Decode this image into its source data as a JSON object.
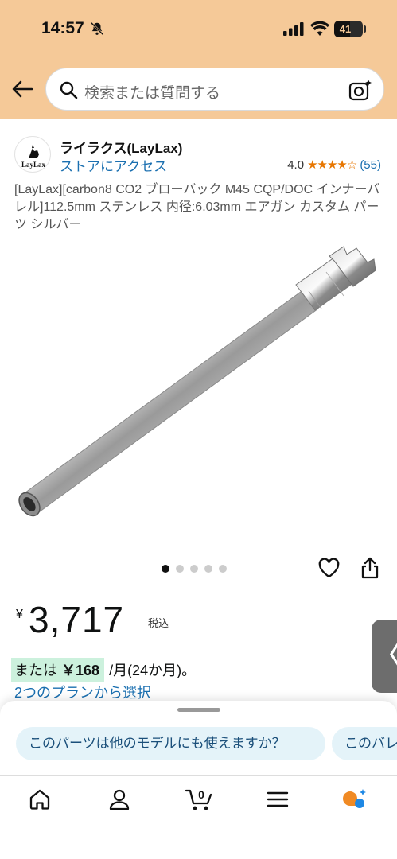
{
  "status_bar": {
    "time": "14:57",
    "battery": "41"
  },
  "search": {
    "placeholder": "検索または質問する"
  },
  "brand": {
    "name": "ライラクス(LayLax)",
    "store_link": "ストアにアクセス",
    "logo_text": "LayLax"
  },
  "rating": {
    "value": "4.0",
    "stars": "★★★★☆",
    "count": "(55)"
  },
  "product": {
    "title": "[LayLax][carbon8 CO2 ブローバック M45 CQP/DOC インナーバレル]112.5mm ステンレス 内径:6.03mm エアガン カスタム パーツ シルバー"
  },
  "gallery": {
    "image_count": 5,
    "active_index": 0
  },
  "price": {
    "currency": "¥",
    "amount": "3,717",
    "tax": "税込"
  },
  "installment": {
    "prefix": "または",
    "amount": "￥168",
    "suffix": "/月(24か月)。",
    "plans_link": "2つのプランから選択"
  },
  "side_tab": {
    "glyph": "〈"
  },
  "suggestions": [
    "このパーツは他のモデルにも使えますか？",
    "このバレ"
  ],
  "nav": {
    "items": [
      "home-icon",
      "account-icon",
      "cart-icon",
      "menu-icon",
      "rufus-icon"
    ],
    "cart_count": "0"
  },
  "colors": {
    "header": "#f5c998",
    "link": "#1a6fb0",
    "star": "#e77600",
    "highlight": "#ccf1dd",
    "chip": "#e4f3f9"
  }
}
